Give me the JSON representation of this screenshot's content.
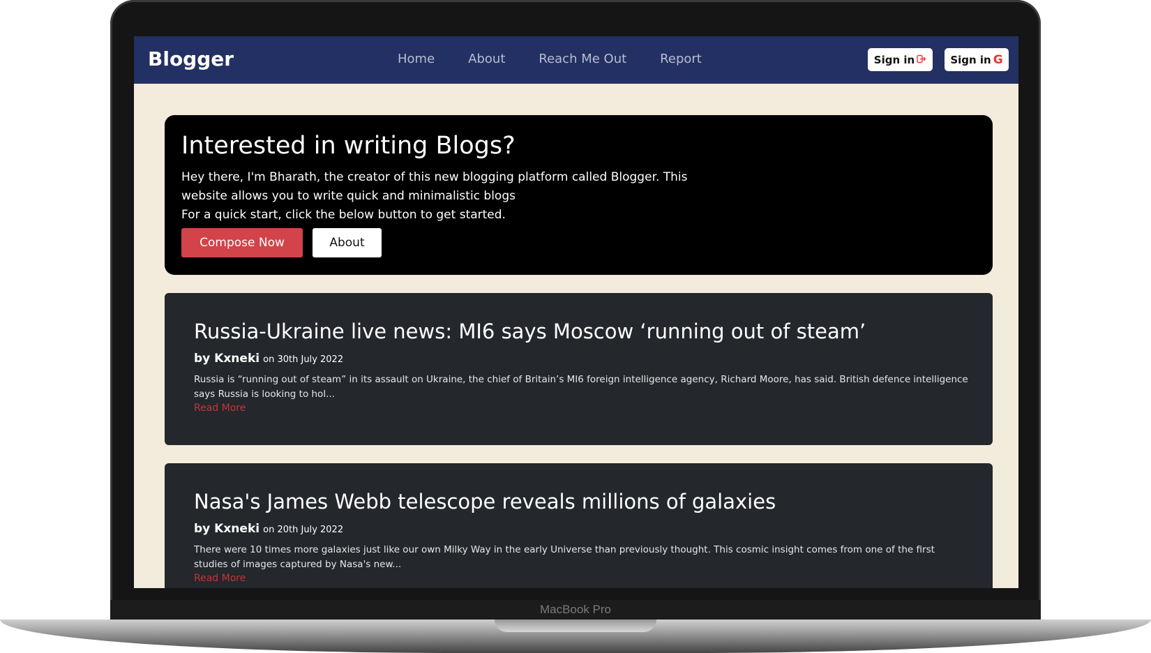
{
  "device": {
    "model_label": "MacBook Pro"
  },
  "navbar": {
    "brand": "Blogger",
    "links": [
      "Home",
      "About",
      "Reach Me Out",
      "Report"
    ],
    "sign_in_label": "Sign in",
    "sign_in_google_label": "Sign in",
    "google_glyph": "G"
  },
  "hero": {
    "title": "Interested in writing Blogs?",
    "body_line_1": "Hey there, I'm Bharath, the creator of this new blogging platform called Blogger. This website allows you to write quick and minimalistic blogs",
    "body_line_2": "For a quick start, click the below button to get started.",
    "compose_label": "Compose Now",
    "about_label": "About"
  },
  "posts": [
    {
      "title": "Russia-Ukraine live news: MI6 says Moscow ‘running out of steam’",
      "author": "by Kxneki",
      "date": "on 30th July 2022",
      "excerpt": "Russia is “running out of steam” in its assault on Ukraine, the chief of Britain’s MI6 foreign intelligence agency, Richard Moore, has said. British defence intelligence says Russia is looking to hol...",
      "read_more": "Read More"
    },
    {
      "title": "Nasa's James Webb telescope reveals millions of galaxies",
      "author": "by Kxneki",
      "date": "on 20th July 2022",
      "excerpt": "There were 10 times more galaxies just like our own Milky Way in the early Universe than previously thought. This cosmic insight comes from one of the first studies of images captured by Nasa's new...",
      "read_more": "Read More"
    }
  ],
  "colors": {
    "navbar_bg": "#233063",
    "page_bg": "#f3ebdc",
    "hero_bg": "#000000",
    "post_bg": "#24272c",
    "accent_red": "#d2444a"
  }
}
